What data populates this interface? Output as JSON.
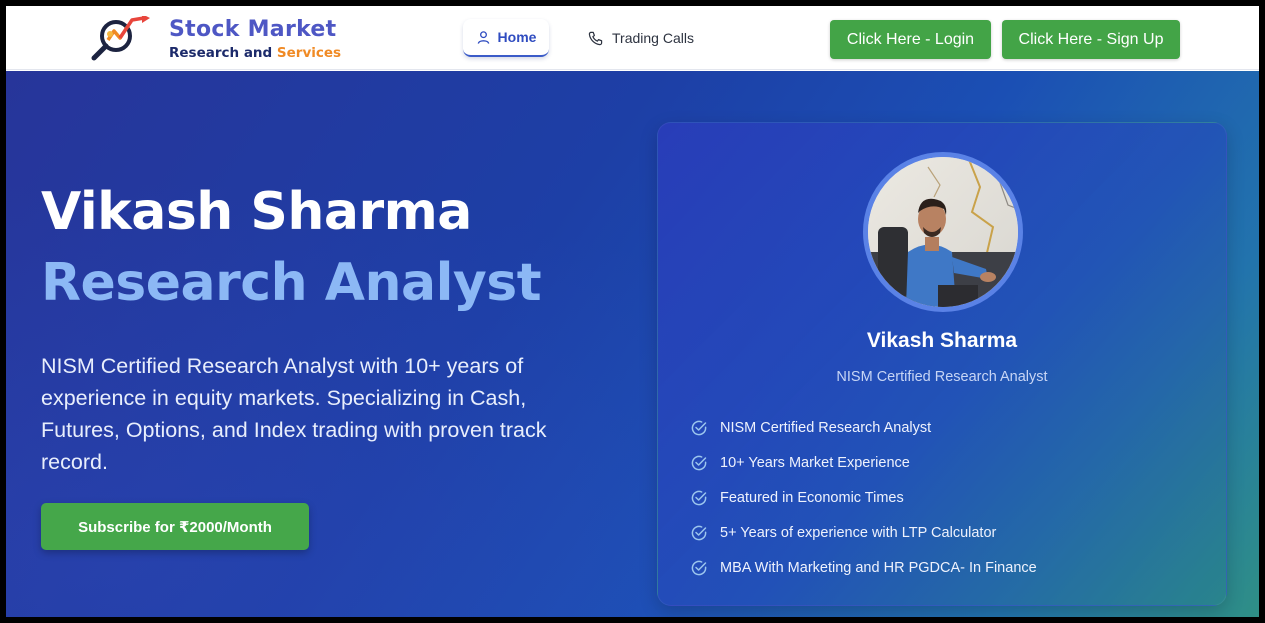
{
  "logo": {
    "title": "Stock Market",
    "subtitle_prefix": "Research and ",
    "subtitle_highlight": "Services",
    "icon": "magnifier-chart-icon"
  },
  "nav": {
    "home": "Home",
    "trading_calls": "Trading Calls",
    "home_icon": "user-icon",
    "calls_icon": "phone-icon"
  },
  "auth": {
    "login": "Click Here - Login",
    "signup": "Click Here - Sign Up"
  },
  "hero": {
    "name": "Vikash Sharma",
    "role": "Research Analyst",
    "description": "NISM Certified Research Analyst with 10+ years of experience in equity markets. Specializing in Cash, Futures, Options, and Index trading with proven track record.",
    "cta": "Subscribe for ₹2000/Month"
  },
  "profile": {
    "name": "Vikash Sharma",
    "title": "NISM Certified Research Analyst",
    "features": [
      "NISM Certified Research Analyst",
      "10+ Years Market Experience",
      "Featured in Economic Times",
      "5+ Years of experience with LTP Calculator",
      "MBA With Marketing and HR PGDCA- In Finance"
    ],
    "feature_icon": "check-circle-icon"
  },
  "colors": {
    "brand": "#4e57c4",
    "accent_orange": "#f08a24",
    "button_green": "#43a447",
    "hero_highlight": "#8cb8f5"
  }
}
